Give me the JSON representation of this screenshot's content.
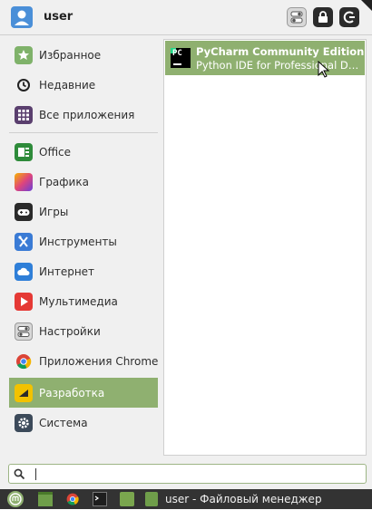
{
  "header": {
    "username": "user",
    "buttons": [
      {
        "name": "toggle-icon"
      },
      {
        "name": "lock-icon"
      },
      {
        "name": "logout-icon"
      }
    ]
  },
  "sidebar": {
    "items": [
      {
        "label": "Избранное",
        "icon": "favorites-icon",
        "color": "#7fb26a"
      },
      {
        "label": "Недавние",
        "icon": "clock-icon",
        "color": "#222222"
      },
      {
        "label": "Все приложения",
        "icon": "grid-icon",
        "color": "#5a3f6e"
      },
      {
        "label": "Office",
        "icon": "office-icon",
        "color": "#2e8b3a"
      },
      {
        "label": "Графика",
        "icon": "graphics-icon",
        "color": "#e0457b"
      },
      {
        "label": "Игры",
        "icon": "gamepad-icon",
        "color": "#2a2a2a"
      },
      {
        "label": "Инструменты",
        "icon": "tools-icon",
        "color": "#3a7bd5"
      },
      {
        "label": "Интернет",
        "icon": "cloud-icon",
        "color": "#2f7fd8"
      },
      {
        "label": "Мультимедиа",
        "icon": "play-icon",
        "color": "#e53935"
      },
      {
        "label": "Настройки",
        "icon": "settings-toggle-icon",
        "color": "#d8d8d8"
      },
      {
        "label": "Приложения Chrome",
        "icon": "chrome-icon",
        "color": "#4285f4"
      },
      {
        "label": "Разработка",
        "icon": "development-icon",
        "color": "#f2c200"
      },
      {
        "label": "Система",
        "icon": "gear-icon",
        "color": "#3c4a5a"
      }
    ],
    "active_index": 11
  },
  "apps": [
    {
      "title": "PyCharm Community Edition",
      "description": "Python IDE for Professional Developers",
      "icon": "pycharm-icon",
      "icon_text": "PC"
    }
  ],
  "search": {
    "value": ""
  },
  "taskbar": {
    "window_label": "user - Файловый менеджер",
    "items": [
      "mint-menu-icon",
      "show-desktop-icon",
      "chrome-icon",
      "terminal-icon",
      "folder-icon",
      "file-manager-icon"
    ]
  },
  "colors": {
    "accent": "#8fb070",
    "taskbar": "#333333",
    "menu_bg": "#f0f0f0"
  }
}
